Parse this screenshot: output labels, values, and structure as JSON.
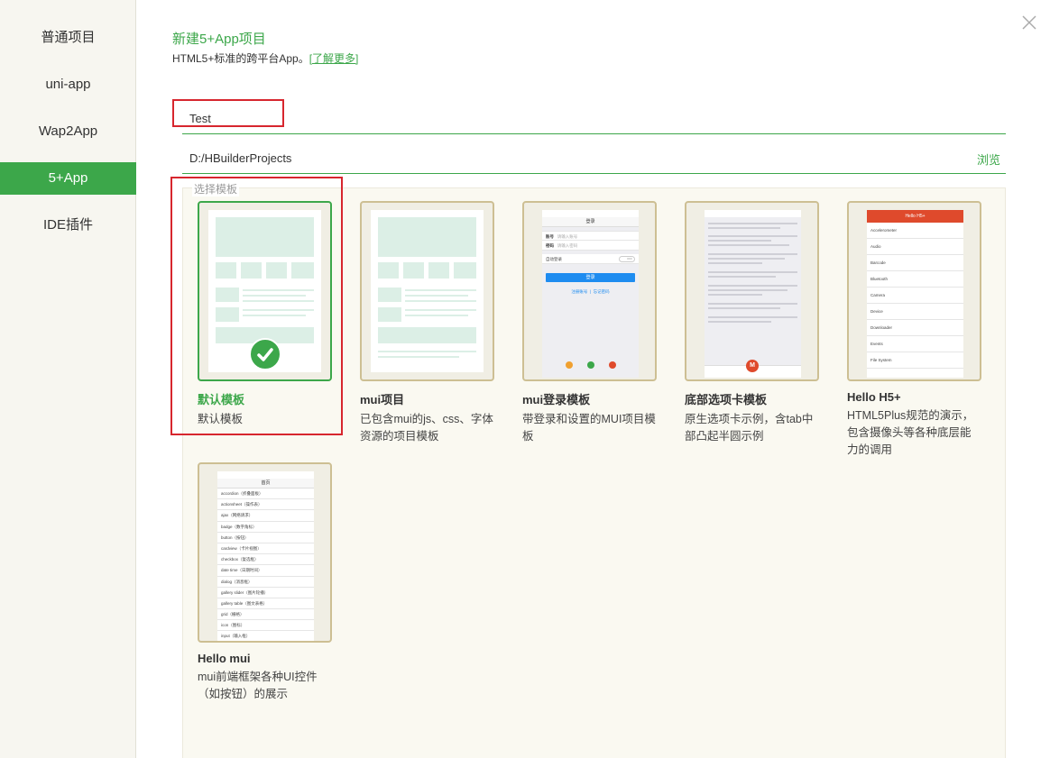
{
  "sidebar": {
    "items": [
      {
        "label": "普通项目"
      },
      {
        "label": "uni-app"
      },
      {
        "label": "Wap2App"
      },
      {
        "label": "5+App"
      },
      {
        "label": "IDE插件"
      }
    ],
    "active_index": 3
  },
  "header": {
    "title": "新建5+App项目",
    "subtitle": "HTML5+标准的跨平台App。",
    "learn_more": "[了解更多]"
  },
  "form": {
    "project_name": "Test",
    "location": "D:/HBuilderProjects",
    "browse_label": "浏览"
  },
  "templates": {
    "legend": "选择模板",
    "selected_index": 0,
    "items": [
      {
        "name": "默认模板",
        "desc": "默认模板"
      },
      {
        "name": "mui项目",
        "desc": "已包含mui的js、css、字体资源的项目模板"
      },
      {
        "name": "mui登录模板",
        "desc": "带登录和设置的MUI项目模板"
      },
      {
        "name": "底部选项卡模板",
        "desc": "原生选项卡示例，含tab中部凸起半圆示例"
      },
      {
        "name": "Hello H5+",
        "desc": "HTML5Plus规范的演示，包含摄像头等各种底层能力的调用"
      },
      {
        "name": "Hello mui",
        "desc": "mui前端框架各种UI控件（如按钮）的展示"
      }
    ]
  },
  "thumbs": {
    "login": {
      "title": "登录",
      "account": "账号",
      "account_ph": "请输入账号",
      "password": "密码",
      "password_ph": "请输入密码",
      "auto_login": "自动登录",
      "toggle": "OFF",
      "button": "登录",
      "register": "注册账号",
      "forgot": "忘记密码"
    },
    "tab": {
      "center": "M"
    },
    "h5": {
      "title": "Hello H5+",
      "rows": [
        "Accelerometer",
        "Audio",
        "Barcode",
        "Bluetooth",
        "Camera",
        "Device",
        "Downloader",
        "Events",
        "File System"
      ]
    },
    "mui": {
      "title": "首页",
      "rows": [
        "accordion（折叠面板）",
        "actionsheet（操作表）",
        "ajax（网络请求）",
        "badge（数字角标）",
        "button（按钮）",
        "cardview（卡片视图）",
        "checkbox（复选框）",
        "date time（日期时间）",
        "dialog（消息框）",
        "gallery slider（图片轮播）",
        "gallery table（图文表格）",
        "grid（栅格）",
        "icon（图标）",
        "input（输入框）"
      ]
    }
  },
  "colors": {
    "accent": "#3ca74a",
    "highlight_box": "#d7262e",
    "thumb_border": "#cdbf93"
  },
  "icons": {
    "close": "close-icon",
    "selected": "check-circle-icon"
  }
}
